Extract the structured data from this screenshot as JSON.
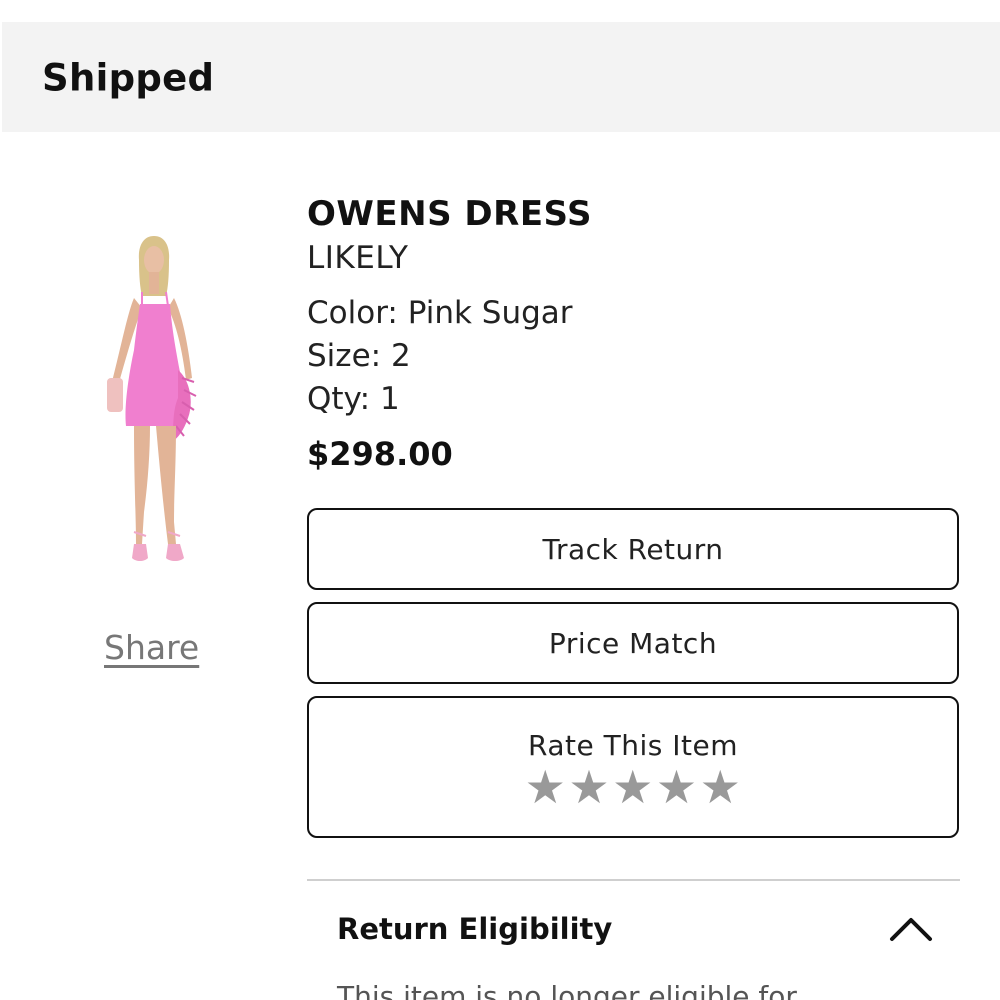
{
  "status": {
    "title": "Shipped"
  },
  "product": {
    "name": "OWENS DRESS",
    "brand": "LIKELY",
    "color_label": "Color:",
    "color_value": "Pink Sugar",
    "size_label": "Size:",
    "size_value": "2",
    "qty_label": "Qty:",
    "qty_value": "1",
    "price": "$298.00",
    "image_icon": "dress-photo",
    "dress_color": "#f07fcf"
  },
  "share": {
    "label": "Share"
  },
  "actions": {
    "track_return": "Track Return",
    "price_match": "Price Match",
    "rate_item": "Rate This Item",
    "star": "★",
    "stars_count": 5,
    "star_color": "#999999"
  },
  "return_eligibility": {
    "title": "Return Eligibility",
    "expanded": true,
    "text": "This item is no longer eligible for"
  }
}
